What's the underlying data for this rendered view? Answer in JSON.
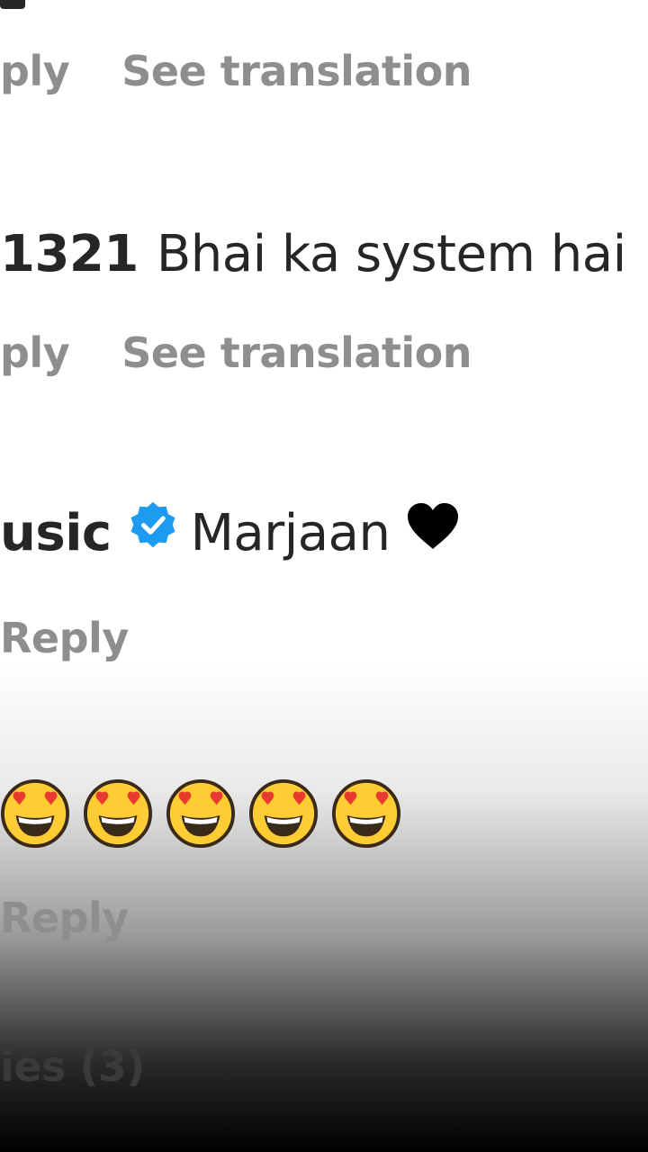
{
  "comments": [
    {
      "actions": {
        "reply": "ply",
        "translate": "See translation"
      }
    },
    {
      "username": "1321",
      "text": "Bhai ka system hai",
      "actions": {
        "reply": "ply",
        "translate": "See translation"
      }
    },
    {
      "username": "usic",
      "verified": true,
      "text": "Marjaan",
      "emoji": "black-heart",
      "actions": {
        "reply": "Reply"
      }
    },
    {
      "emoji": "heart-eyes-face",
      "emoji_count": 5,
      "actions": {
        "reply": "Reply"
      }
    }
  ],
  "view_replies": "ies (3)",
  "colors": {
    "text": "#262626",
    "secondary": "#8e8e8e",
    "verified_blue": "#1d9bf0"
  }
}
